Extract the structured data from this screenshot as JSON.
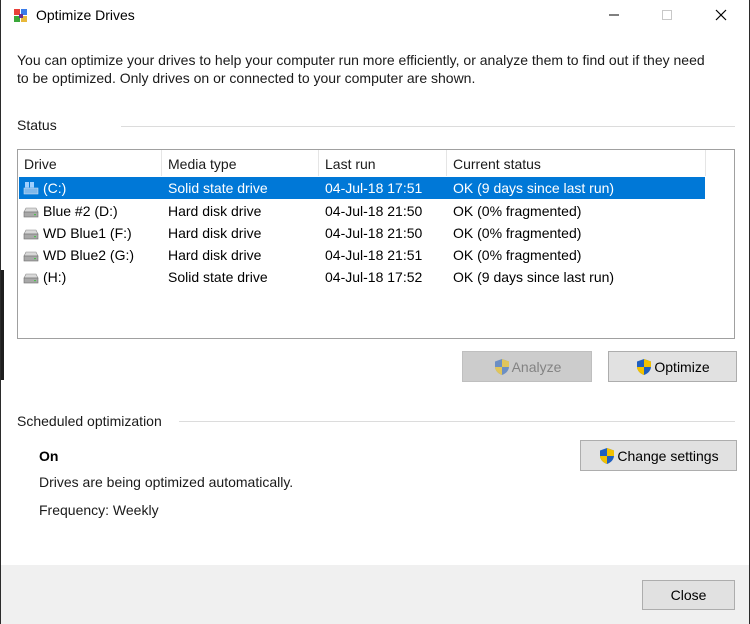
{
  "window": {
    "title": "Optimize Drives",
    "icons": {
      "app": "defrag-icon",
      "minimize": "minimize-icon",
      "maximize": "maximize-icon",
      "close": "close-icon"
    }
  },
  "description": "You can optimize your drives to help your computer run more efficiently, or analyze them to find out if they need to be optimized. Only drives on or connected to your computer are shown.",
  "status": {
    "label": "Status",
    "columns": [
      "Drive",
      "Media type",
      "Last run",
      "Current status"
    ],
    "rows": [
      {
        "drive": "(C:)",
        "media": "Solid state drive",
        "last_run": "04-Jul-18 17:51",
        "status": "OK (9 days since last run)",
        "icon": "windows-drive-icon",
        "selected": true
      },
      {
        "drive": "Blue #2 (D:)",
        "media": "Hard disk drive",
        "last_run": "04-Jul-18 21:50",
        "status": "OK (0% fragmented)",
        "icon": "hard-drive-icon"
      },
      {
        "drive": "WD Blue1 (F:)",
        "media": "Hard disk drive",
        "last_run": "04-Jul-18 21:50",
        "status": "OK (0% fragmented)",
        "icon": "hard-drive-icon"
      },
      {
        "drive": "WD Blue2 (G:)",
        "media": "Hard disk drive",
        "last_run": "04-Jul-18 21:51",
        "status": "OK (0% fragmented)",
        "icon": "hard-drive-icon"
      },
      {
        "drive": "(H:)",
        "media": "Solid state drive",
        "last_run": "04-Jul-18 17:52",
        "status": "OK (9 days since last run)",
        "icon": "hard-drive-icon"
      }
    ],
    "analyze_label": "Analyze",
    "optimize_label": "Optimize"
  },
  "scheduled": {
    "label": "Scheduled optimization",
    "state": "On",
    "description": "Drives are being optimized automatically.",
    "frequency": "Frequency: Weekly",
    "change_settings_label": "Change settings"
  },
  "footer": {
    "close_label": "Close"
  },
  "colors": {
    "selection": "#0078d7",
    "shield_blue": "#1f5fbf",
    "shield_yellow": "#f2c100"
  }
}
